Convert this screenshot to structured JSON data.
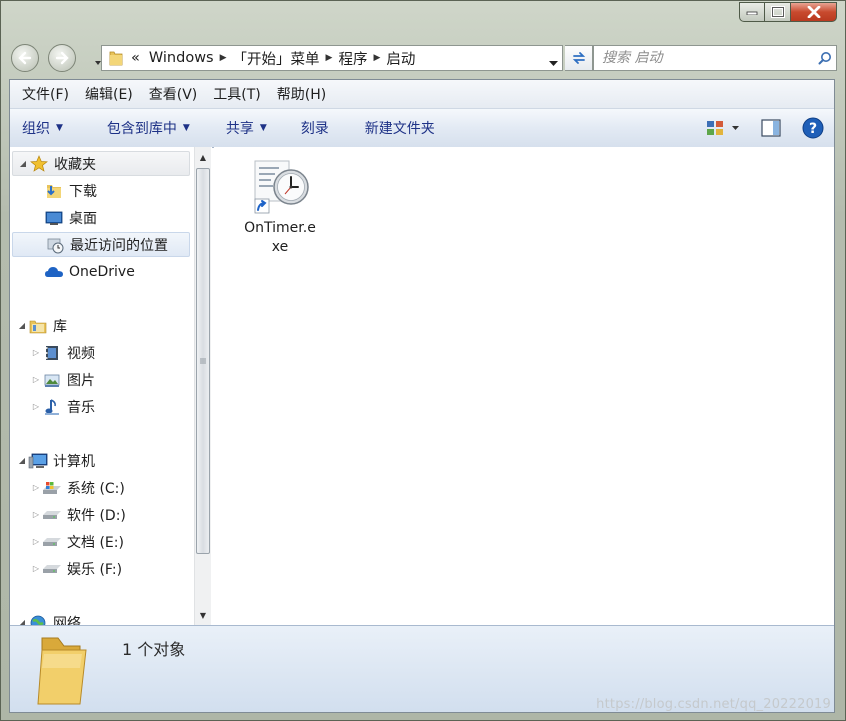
{
  "address": {
    "overflow": "«",
    "crumbs": [
      "Windows",
      "「开始」菜单",
      "程序",
      "启动"
    ]
  },
  "search": {
    "placeholder": "搜索 启动"
  },
  "menubar": [
    "文件(F)",
    "编辑(E)",
    "查看(V)",
    "工具(T)",
    "帮助(H)"
  ],
  "commandbar": {
    "organize": "组织",
    "include_library": "包含到库中",
    "share": "共享",
    "burn": "刻录",
    "new_folder": "新建文件夹"
  },
  "navpane": {
    "favorites": {
      "label": "收藏夹",
      "items": [
        "下载",
        "桌面",
        "最近访问的位置"
      ]
    },
    "onedrive": "OneDrive",
    "libraries": {
      "label": "库",
      "items": [
        "视频",
        "图片",
        "音乐"
      ]
    },
    "computer": {
      "label": "计算机",
      "items": [
        "系统 (C:)",
        "软件 (D:)",
        "文档 (E:)",
        "娱乐 (F:)"
      ]
    },
    "network": "网络"
  },
  "files": [
    {
      "name": "OnTimer.exe",
      "line1": "OnTimer.e",
      "line2": "xe",
      "icon": "shortcut-clock-icon"
    }
  ],
  "details": {
    "count": "1 个对象"
  },
  "watermark": "https://blog.csdn.net/qq_20222019",
  "colors": {
    "command_text": "#1e3287",
    "help_blue": "#1f5fb8",
    "close_red": "#c84a2e"
  }
}
